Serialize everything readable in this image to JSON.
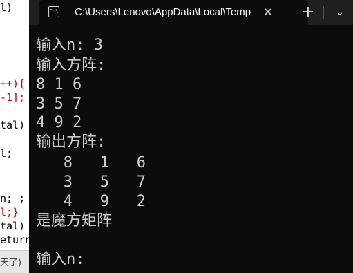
{
  "editor": {
    "lines": [
      {
        "text": "l)",
        "color": "#000000"
      },
      {
        "text": "++){",
        "color": "#d00000"
      },
      {
        "text": "-1];",
        "color": "#d00000"
      },
      {
        "text": "tal)",
        "color": "#000000"
      },
      {
        "text": "l;",
        "color": "#000000"
      },
      {
        "text": "n; ;",
        "color": "#000000"
      },
      {
        "text": "l;}",
        "color": "#d00000"
      },
      {
        "text": "tal)",
        "color": "#000000"
      },
      {
        "text": "eturn",
        "color": "#000000"
      }
    ],
    "status_fragment": "天了)"
  },
  "terminal": {
    "tab": {
      "icon": "terminal-app-icon",
      "title": "C:\\Users\\Lenovo\\AppData\\Local\\Temp",
      "close_glyph": "✕"
    },
    "new_tab_glyph": "+",
    "dropdown_glyph": "⌄",
    "lines": [
      "输入n: 3",
      "输入方阵:",
      "8 1 6",
      "3 5 7",
      "4 9 2",
      "输出方阵:",
      "   8   1   6",
      "   3   5   7",
      "   4   9   2",
      "是魔方矩阵",
      "",
      "输入n:"
    ],
    "text_color": "#cccccc",
    "background": "#0c0c0c"
  }
}
